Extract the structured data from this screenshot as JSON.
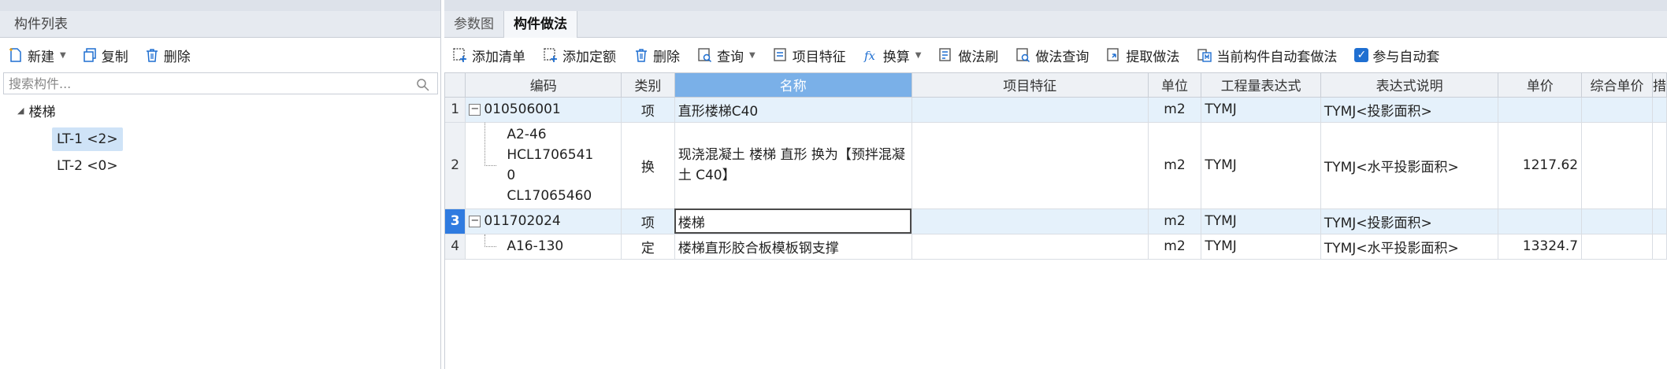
{
  "left_panel": {
    "title": "构件列表",
    "toolbar": {
      "new_label": "新建",
      "copy_label": "复制",
      "delete_label": "删除"
    },
    "search_placeholder": "搜索构件...",
    "tree": {
      "root_label": "楼梯",
      "children": [
        {
          "label": "LT-1 <2>",
          "selected": true
        },
        {
          "label": "LT-2 <0>",
          "selected": false
        }
      ]
    }
  },
  "right_panel": {
    "tabs": [
      {
        "label": "参数图",
        "active": false
      },
      {
        "label": "构件做法",
        "active": true
      }
    ],
    "toolbar": {
      "add_list": "添加清单",
      "add_quota": "添加定额",
      "delete": "删除",
      "query": "查询",
      "item_feature": "项目特征",
      "convert": "换算",
      "method_brush": "做法刷",
      "method_query": "做法查询",
      "extract_method": "提取做法",
      "auto_method": "当前构件自动套做法",
      "auto_join": "参与自动套"
    },
    "grid": {
      "columns": [
        "",
        "编码",
        "类别",
        "名称",
        "项目特征",
        "单位",
        "工程量表达式",
        "表达式说明",
        "单价",
        "综合单价",
        "措"
      ],
      "rows": [
        {
          "num": "1",
          "code": "010506001",
          "type": "项",
          "name": "直形楼梯C40",
          "feature": "",
          "unit": "m2",
          "expr": "TYMJ",
          "expr_desc": "TYMJ<投影面积>",
          "price": "",
          "total_price": ""
        },
        {
          "num": "2",
          "code_lines": [
            "A2-46",
            "HCL1706541",
            "0",
            "CL17065460"
          ],
          "type": "换",
          "name": "现浇混凝土 楼梯 直形  换为【预拌混凝土 C40】",
          "feature": "",
          "unit": "m2",
          "expr": "TYMJ",
          "expr_desc": "TYMJ<水平投影面积>",
          "price": "1217.62",
          "total_price": ""
        },
        {
          "num": "3",
          "code": "011702024",
          "type": "项",
          "name": "楼梯",
          "feature": "",
          "unit": "m2",
          "expr": "TYMJ",
          "expr_desc": "TYMJ<投影面积>",
          "price": "",
          "total_price": ""
        },
        {
          "num": "4",
          "code": "A16-130",
          "type": "定",
          "name": "楼梯直形胶合板模板钢支撑",
          "feature": "",
          "unit": "m2",
          "expr": "TYMJ",
          "expr_desc": "TYMJ<水平投影面积>",
          "price": "13324.7",
          "total_price": ""
        }
      ],
      "expand_symbol": "−"
    }
  },
  "colors": {
    "accent": "#1f6fd1",
    "header_highlight": "#7ab0e8",
    "row_highlight": "#e5f1fb",
    "tree_selected": "#cfe3f7"
  },
  "icons": [
    "new-icon",
    "copy-icon",
    "trash-icon",
    "search-icon",
    "add-list-icon",
    "add-quota-icon",
    "query-icon",
    "feature-icon",
    "fx-icon",
    "brush-icon",
    "method-query-icon",
    "extract-icon",
    "auto-icon",
    "checkbox-icon"
  ]
}
